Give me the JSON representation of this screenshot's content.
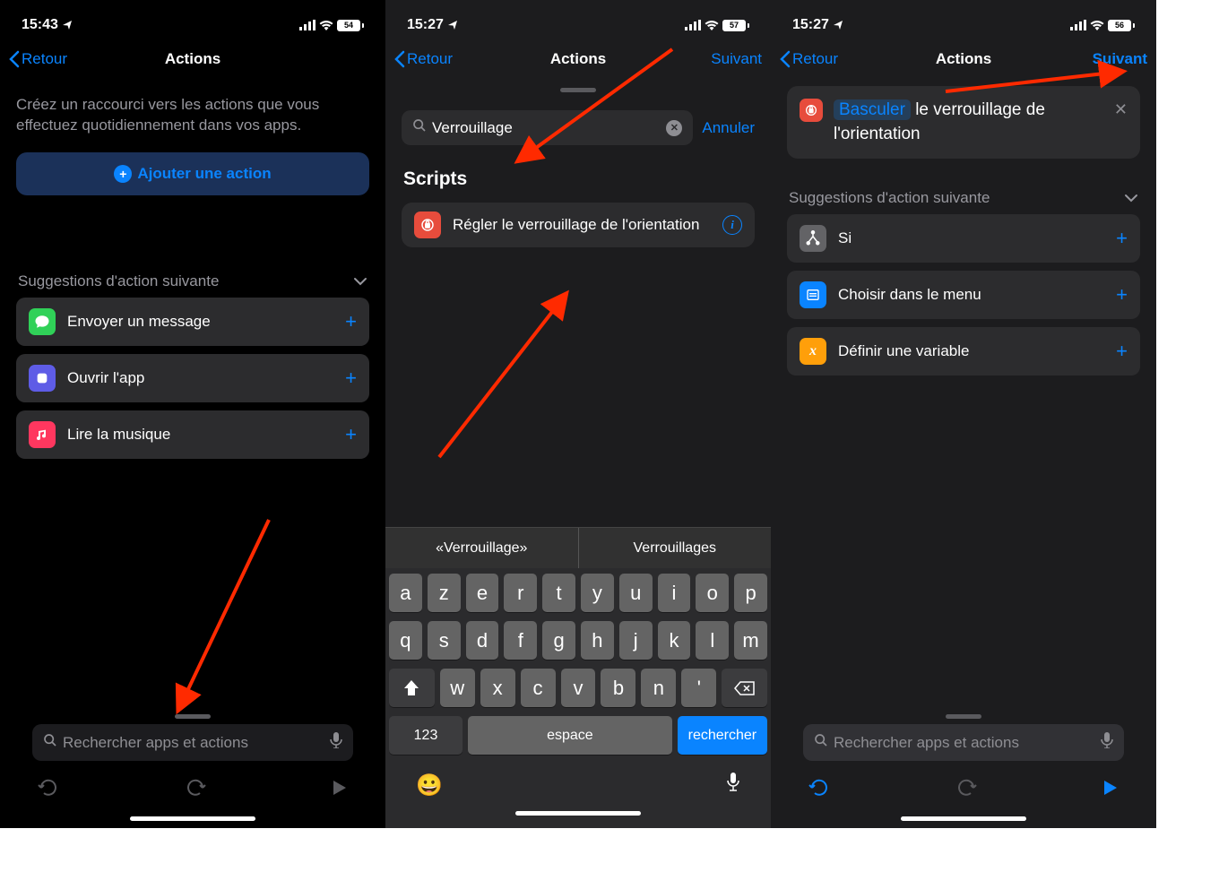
{
  "phone1": {
    "status": {
      "time": "15:43",
      "battery": "54"
    },
    "nav": {
      "back": "Retour",
      "title": "Actions"
    },
    "desc": "Créez un raccourci vers les actions que vous effectuez quotidiennement dans vos apps.",
    "add_action": "Ajouter une action",
    "sugg_header": "Suggestions d'action suivante",
    "sugg": [
      {
        "label": "Envoyer un message"
      },
      {
        "label": "Ouvrir l'app"
      },
      {
        "label": "Lire la musique"
      }
    ],
    "search_ph": "Rechercher apps et actions"
  },
  "phone2": {
    "status": {
      "time": "15:27",
      "battery": "57"
    },
    "nav": {
      "back": "Retour",
      "title": "Actions",
      "next": "Suivant"
    },
    "search_value": "Verrouillage",
    "cancel": "Annuler",
    "scripts_header": "Scripts",
    "script_item": "Régler le verrouillage de l'orientation",
    "kb": {
      "sug1": "«Verrouillage»",
      "sug2": "Verrouillages",
      "row1": [
        "a",
        "z",
        "e",
        "r",
        "t",
        "y",
        "u",
        "i",
        "o",
        "p"
      ],
      "row2": [
        "q",
        "s",
        "d",
        "f",
        "g",
        "h",
        "j",
        "k",
        "l",
        "m"
      ],
      "row3": [
        "w",
        "x",
        "c",
        "v",
        "b",
        "n",
        "'"
      ],
      "num": "123",
      "space": "espace",
      "ret": "rechercher"
    }
  },
  "phone3": {
    "status": {
      "time": "15:27",
      "battery": "56"
    },
    "nav": {
      "back": "Retour",
      "title": "Actions",
      "next": "Suivant"
    },
    "card_token": "Basculer",
    "card_rest": " le verrouillage de l'orientation",
    "sugg_header": "Suggestions d'action suivante",
    "sugg": [
      {
        "label": "Si"
      },
      {
        "label": "Choisir dans le menu"
      },
      {
        "label": "Définir une variable"
      }
    ],
    "search_ph": "Rechercher apps et actions"
  }
}
